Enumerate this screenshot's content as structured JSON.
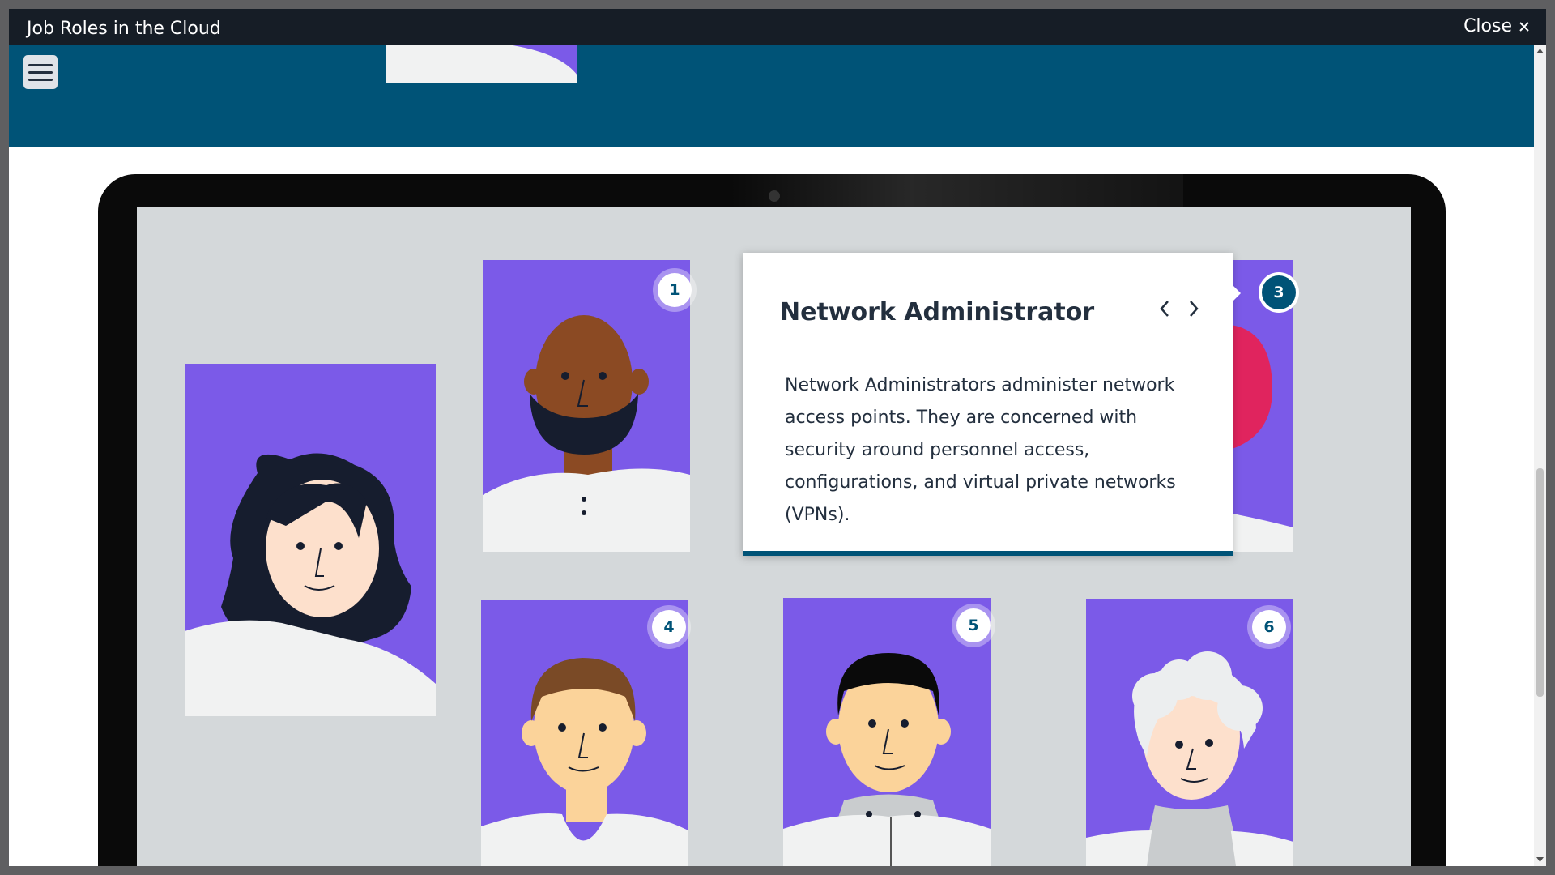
{
  "window": {
    "title": "Job Roles in the Cloud",
    "close_label": "Close"
  },
  "popup": {
    "title": "Network Administrator",
    "body": "Network Administrators administer network access points. They are concerned with security around personnel access, configurations, and virtual private networks (VPNs)."
  },
  "markers": [
    "1",
    "3",
    "4",
    "5",
    "6"
  ],
  "colors": {
    "accent": "#005377",
    "titlebar": "#161d26",
    "card": "#7b5ae8",
    "screen": "#d4d8da"
  }
}
